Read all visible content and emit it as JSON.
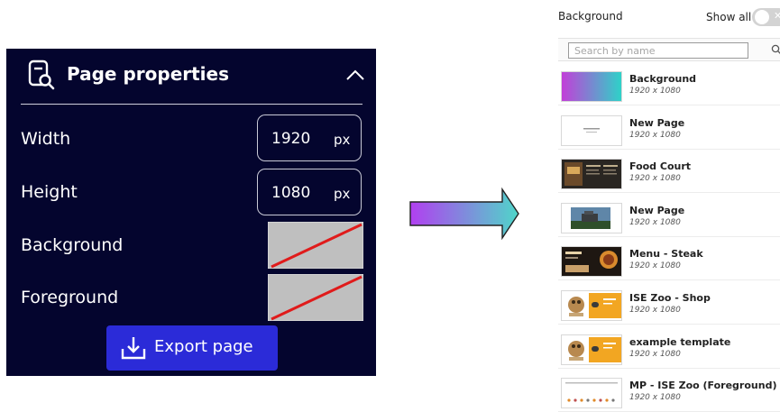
{
  "page_properties": {
    "title": "Page properties",
    "width": {
      "label": "Width",
      "value": "1920",
      "unit": "px"
    },
    "height": {
      "label": "Height",
      "value": "1080",
      "unit": "px"
    },
    "background_label": "Background",
    "foreground_label": "Foreground",
    "export_label": "Export page"
  },
  "picker": {
    "title": "Background",
    "show_all_label": "Show all",
    "show_all_on": false,
    "search_placeholder": "Search by name",
    "items": [
      {
        "name": "Background",
        "size": "1920 x 1080",
        "thumb": "gradient"
      },
      {
        "name": "New Page",
        "size": "1920 x 1080",
        "thumb": "blank"
      },
      {
        "name": "Food Court",
        "size": "1920 x 1080",
        "thumb": "dark-menu"
      },
      {
        "name": "New Page",
        "size": "1920 x 1080",
        "thumb": "photo"
      },
      {
        "name": "Menu - Steak",
        "size": "1920 x 1080",
        "thumb": "steak"
      },
      {
        "name": "ISE Zoo - Shop",
        "size": "1920 x 1080",
        "thumb": "zoo"
      },
      {
        "name": "example template",
        "size": "1920 x 1080",
        "thumb": "zoo"
      },
      {
        "name": "MP - ISE Zoo (Foreground)",
        "size": "1920 x 1080",
        "thumb": "strip"
      }
    ]
  },
  "colors": {
    "panel_bg": "#04052e",
    "export_button": "#2b2bd8",
    "swatch_fill": "#bfbfbf",
    "swatch_slash": "#e01b1b",
    "arrow_gradient": [
      "#b13ff0",
      "#4fd6c9"
    ]
  }
}
